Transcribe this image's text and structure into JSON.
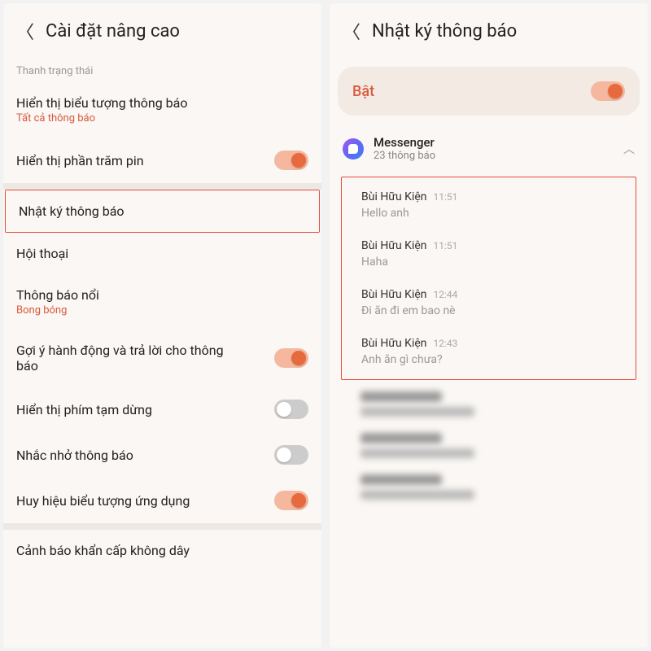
{
  "left": {
    "title": "Cài đặt nâng cao",
    "section": "Thanh trạng thái",
    "items": {
      "notif_icons": {
        "title": "Hiển thị biểu tượng thông báo",
        "sub": "Tất cả thông báo"
      },
      "battery": {
        "title": "Hiển thị phần trăm pin"
      },
      "log": {
        "title": "Nhật ký thông báo"
      },
      "convo": {
        "title": "Hội thoại"
      },
      "floating": {
        "title": "Thông báo nổi",
        "sub": "Bong bóng"
      },
      "suggest": {
        "title": "Gợi ý hành động và trả lời cho thông báo"
      },
      "pause": {
        "title": "Hiển thị phím tạm dừng"
      },
      "remind": {
        "title": "Nhắc nhở thông báo"
      },
      "badge": {
        "title": "Huy hiệu biểu tượng ứng dụng"
      },
      "emergency": {
        "title": "Cảnh báo khẩn cấp không dây"
      }
    }
  },
  "right": {
    "title": "Nhật ký thông báo",
    "enable": "Bật",
    "app": {
      "name": "Messenger",
      "count": "23 thông báo"
    },
    "notifs": [
      {
        "name": "Bùi Hữu Kiện",
        "time": "11:51",
        "msg": "Hello anh"
      },
      {
        "name": "Bùi Hữu Kiện",
        "time": "11:51",
        "msg": "Haha"
      },
      {
        "name": "Bùi Hữu Kiện",
        "time": "12:44",
        "msg": "Đi ăn đi em bao nè"
      },
      {
        "name": "Bùi Hữu Kiện",
        "time": "12:43",
        "msg": "Anh ăn gì chưa?"
      }
    ]
  }
}
